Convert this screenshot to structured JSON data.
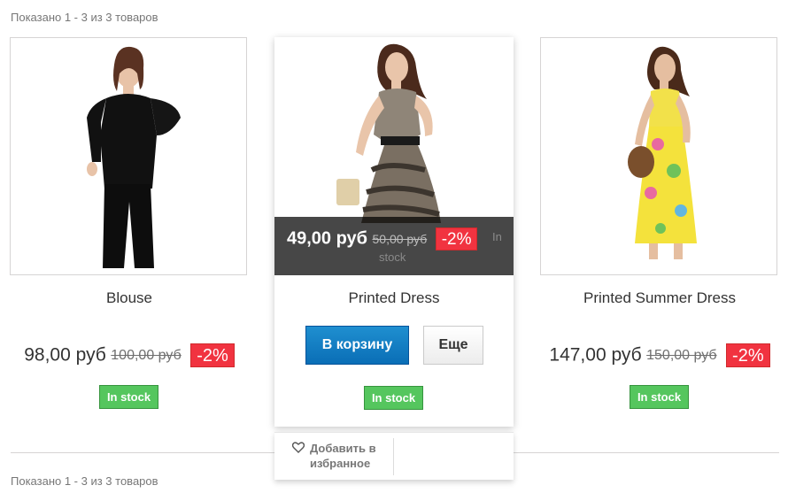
{
  "listing": {
    "count_top": "Показано 1 - 3 из 3 товаров",
    "count_bottom": "Показано 1 - 3 из 3 товаров"
  },
  "products": [
    {
      "name": "Blouse",
      "price": "98,00 руб",
      "old_price": "100,00 руб",
      "reduction": "-2%",
      "stock": "In stock",
      "image": "woman-in-black-blouse"
    },
    {
      "name": "Printed Dress",
      "price": "49,00 руб",
      "old_price": "50,00 руб",
      "reduction": "-2%",
      "stock": "In stock",
      "image": "woman-in-printed-dress",
      "overlay_stock_text_a": "In",
      "overlay_stock_text_b": "stock",
      "add_to_cart": "В корзину",
      "more": "Еще",
      "wishlist": "Добавить в избранное"
    },
    {
      "name": "Printed Summer Dress",
      "price": "147,00 руб",
      "old_price": "150,00 руб",
      "reduction": "-2%",
      "stock": "In stock",
      "image": "woman-in-yellow-summer-dress"
    }
  ],
  "colors": {
    "discount": "#f13340",
    "in_stock": "#55c65e",
    "cart_button": "#0a6eb6"
  },
  "icons": {
    "wishlist": "heart-icon"
  }
}
